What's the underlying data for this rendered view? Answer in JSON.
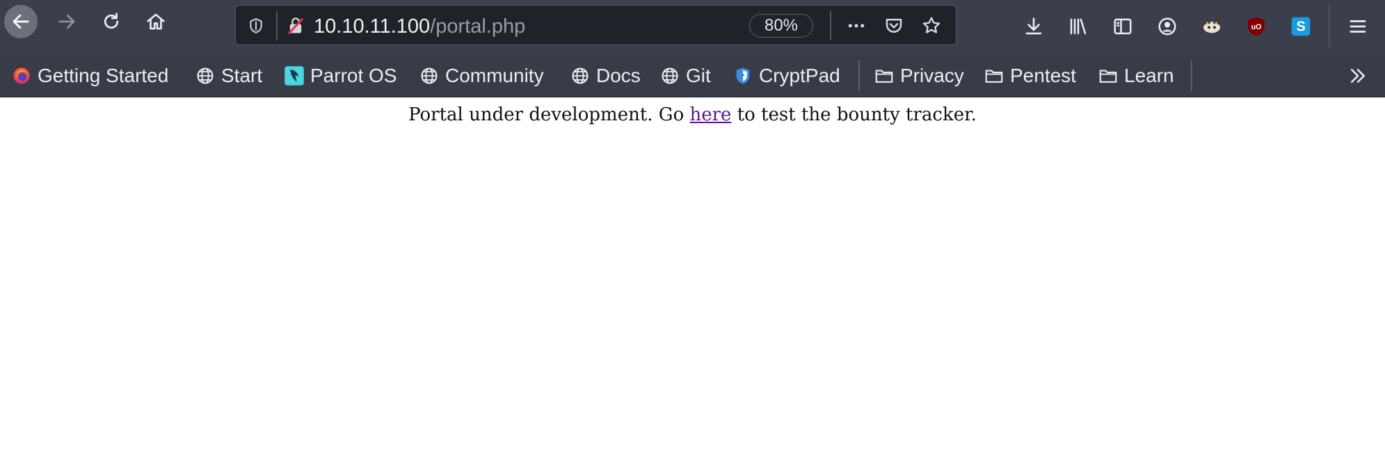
{
  "toolbar": {
    "url_host": "10.10.11.100",
    "url_path": "/portal.php",
    "zoom": "80%"
  },
  "bookmarks": [
    {
      "label": "Getting Started",
      "icon": "firefox-icon"
    },
    {
      "label": "Start",
      "icon": "globe-icon"
    },
    {
      "label": "Parrot OS",
      "icon": "parrot-icon"
    },
    {
      "label": "Community",
      "icon": "globe-icon"
    },
    {
      "label": "Docs",
      "icon": "globe-icon"
    },
    {
      "label": "Git",
      "icon": "globe-icon"
    },
    {
      "label": "CryptPad",
      "icon": "cryptpad-icon"
    },
    {
      "label": "Privacy",
      "icon": "folder-icon"
    },
    {
      "label": "Pentest",
      "icon": "folder-icon"
    },
    {
      "label": "Learn",
      "icon": "folder-icon"
    }
  ],
  "page": {
    "text_before": "Portal under development. Go ",
    "link_text": "here",
    "text_after": " to test the bounty tracker."
  },
  "colors": {
    "toolbar_bg": "#3b3f4b",
    "urlbar_bg": "#1f2229",
    "link_visited": "#551a8b"
  }
}
